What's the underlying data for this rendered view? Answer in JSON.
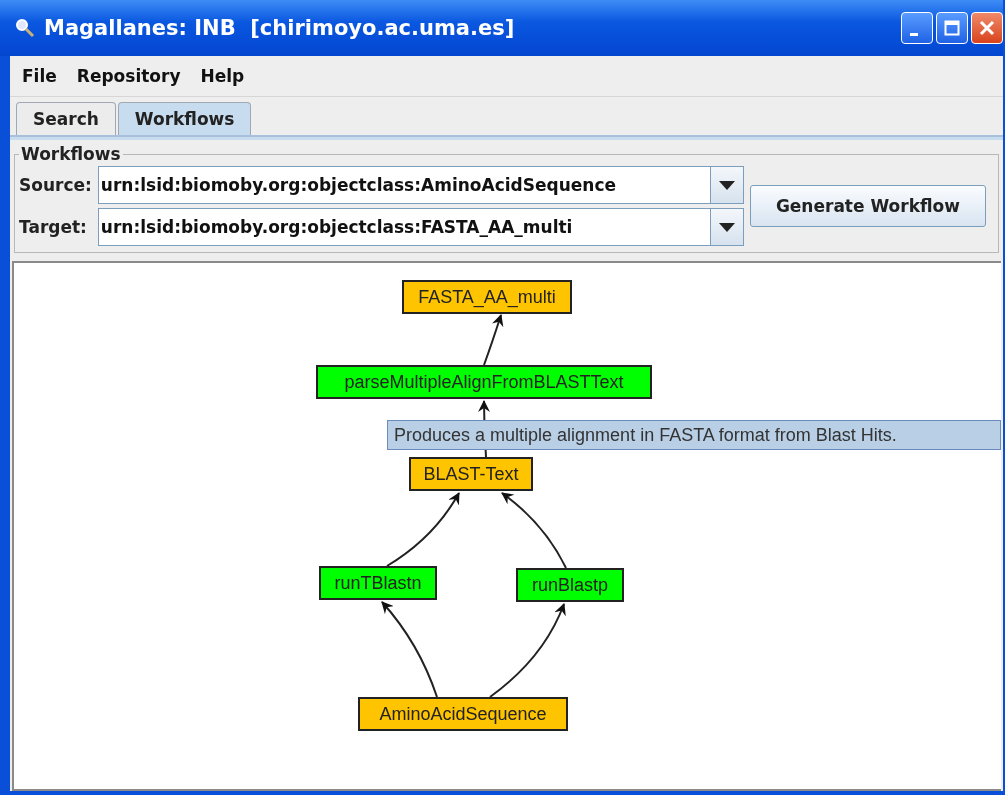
{
  "window": {
    "title": "Magallanes: INB  [chirimoyo.ac.uma.es]"
  },
  "menu": [
    "File",
    "Repository",
    "Help"
  ],
  "tabs": [
    {
      "label": "Search",
      "selected": false
    },
    {
      "label": "Workflows",
      "selected": true
    }
  ],
  "workflows": {
    "legend": "Workflows",
    "source": {
      "label": "Source:",
      "value": "urn:lsid:biomoby.org:objectclass:AminoAcidSequence"
    },
    "target": {
      "label": "Target:",
      "value": "urn:lsid:biomoby.org:objectclass:FASTA_AA_multi"
    },
    "button": "Generate Workflow"
  },
  "graph": {
    "nodes": [
      {
        "label": "FASTA_AA_multi",
        "kind": "data"
      },
      {
        "label": "parseMultipleAlignFromBLASTText",
        "kind": "service"
      },
      {
        "label": "BLAST-Text",
        "kind": "data"
      },
      {
        "label": "runTBlastn",
        "kind": "service"
      },
      {
        "label": "runBlastp",
        "kind": "service"
      },
      {
        "label": "AminoAcidSequence",
        "kind": "data"
      }
    ],
    "tooltip": "Produces a multiple alignment in FASTA format from Blast Hits."
  }
}
